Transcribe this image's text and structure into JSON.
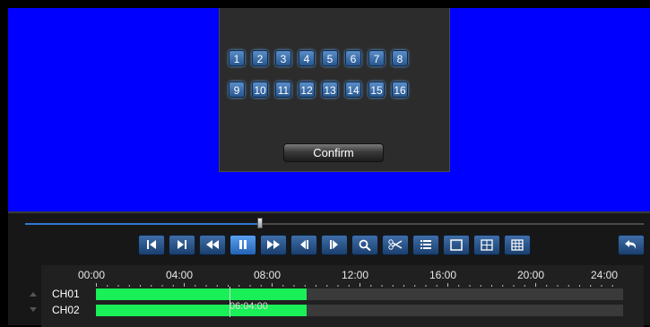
{
  "channel_picker": {
    "row1": [
      "1",
      "2",
      "3",
      "4",
      "5",
      "6",
      "7",
      "8"
    ],
    "row2": [
      "9",
      "10",
      "11",
      "12",
      "13",
      "14",
      "15",
      "16"
    ],
    "confirm_label": "Confirm"
  },
  "playback": {
    "progress": 0.38,
    "toolbar": [
      {
        "name": "skip-to-start-button",
        "icon": "skip-start-icon"
      },
      {
        "name": "skip-to-end-button",
        "icon": "skip-end-icon"
      },
      {
        "name": "rewind-button",
        "icon": "rewind-icon"
      },
      {
        "name": "pause-button",
        "icon": "pause-icon",
        "active": true
      },
      {
        "name": "fast-forward-button",
        "icon": "fast-forward-icon"
      },
      {
        "name": "step-back-button",
        "icon": "step-back-icon"
      },
      {
        "name": "step-forward-button",
        "icon": "step-forward-icon"
      },
      {
        "name": "zoom-button",
        "icon": "magnifier-icon"
      },
      {
        "name": "clip-button",
        "icon": "scissors-icon"
      },
      {
        "name": "list-button",
        "icon": "list-icon"
      },
      {
        "name": "layout-1-button",
        "icon": "layout-single-icon"
      },
      {
        "name": "layout-4-button",
        "icon": "layout-quad-icon"
      },
      {
        "name": "layout-9-button",
        "icon": "layout-nine-icon"
      }
    ],
    "undo_icon": "undo-icon"
  },
  "timeline": {
    "hours": [
      "00:00",
      "04:00",
      "08:00",
      "12:00",
      "16:00",
      "20:00",
      "24:00"
    ],
    "channels": [
      {
        "label": "CH01",
        "recorded_until_hours": 9.6
      },
      {
        "label": "CH02",
        "recorded_until_hours": 9.6
      }
    ],
    "cursor_time": "06:04:00",
    "colors": {
      "video": "#0000fe",
      "record": "#19ef57",
      "accent": "#2f7ad4"
    }
  }
}
